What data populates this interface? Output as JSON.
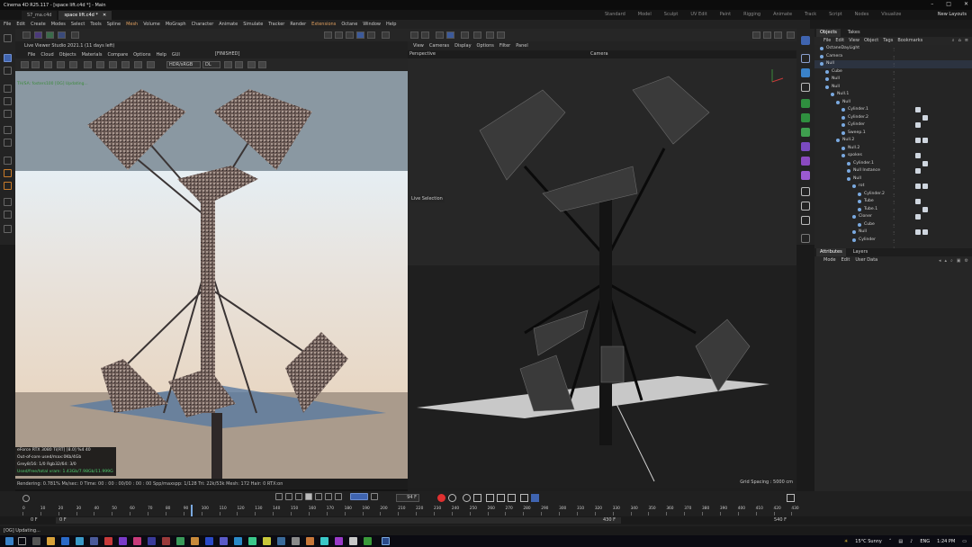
{
  "window": {
    "title": "Cinema 4D R25.117 - [space lift.c4d *] - Main"
  },
  "tabs": [
    {
      "label": "S7_ma.c4d"
    },
    {
      "label": "space lift.c4d *"
    }
  ],
  "layouts": [
    "Standard",
    "Model",
    "Sculpt",
    "UV Edit",
    "Paint",
    "Rigging",
    "Animate",
    "Track",
    "Script",
    "Nodes",
    "Visualize"
  ],
  "new_layouts": "New Layouts",
  "menubar": [
    "File",
    "Edit",
    "Create",
    "Modes",
    "Select",
    "Tools",
    "Spline",
    "Mesh",
    "Volume",
    "MoGraph",
    "Character",
    "Animate",
    "Simulate",
    "Tracker",
    "Render",
    "Extensions",
    "Octane",
    "Window",
    "Help"
  ],
  "live_viewer": {
    "title": "Live Viewer Studio 2021.1 (11 days left)",
    "menu": [
      "File",
      "Cloud",
      "Objects",
      "Materials",
      "Compare",
      "Options",
      "Help",
      "GUI"
    ],
    "status_tag": "[FINISHED]",
    "mode": "HDR/sRGB",
    "channel": "DL",
    "overlay_text": "TH/SA: fosters100  [OG] Updating...",
    "stats": [
      "eForce RTX 3080 Ti[RT]   [8.0] %4      40",
      "Out-of-core used/max:0Kb/4Gb",
      "Grey8/16: 1/0            Rgb32/64: 3/0",
      "Used/free/total vram: 1.43Gb/7.98Gb/11.999G"
    ],
    "status_bar": "Rendering: 0.781%   Ms/sec: 0   Time: 00 : 00 : 00/00 : 00 : 00   Spp/maxspp: 1/128   Tri: 22k/53k   Mesh: 172   Hair: 0   RTX:on"
  },
  "viewport": {
    "menu": [
      "View",
      "Cameras",
      "Display",
      "Options",
      "Filter",
      "Panel"
    ],
    "label": "Perspective",
    "camera": "Camera",
    "live_selection": "Live Selection",
    "grid_spacing": "Grid Spacing : 5000 cm"
  },
  "objects_panel": {
    "tabs": [
      "Objects",
      "Takes"
    ],
    "menu": [
      "File",
      "Edit",
      "View",
      "Object",
      "Tags",
      "Bookmarks"
    ],
    "items": [
      {
        "name": "OctaneDayLight",
        "depth": 0
      },
      {
        "name": "Camera",
        "depth": 0
      },
      {
        "name": "Null",
        "depth": 0
      },
      {
        "name": "Cube",
        "depth": 1
      },
      {
        "name": "Null",
        "depth": 1
      },
      {
        "name": "Null",
        "depth": 1
      },
      {
        "name": "Null.1",
        "depth": 2
      },
      {
        "name": "Null",
        "depth": 3
      },
      {
        "name": "Cylinder.1",
        "depth": 4
      },
      {
        "name": "Cylinder.2",
        "depth": 4
      },
      {
        "name": "Cylinder",
        "depth": 4
      },
      {
        "name": "Sweep.1",
        "depth": 4
      },
      {
        "name": "Null.2",
        "depth": 3
      },
      {
        "name": "Null.2",
        "depth": 4
      },
      {
        "name": "spokes",
        "depth": 4
      },
      {
        "name": "Cylinder.1",
        "depth": 5
      },
      {
        "name": "Null Instance",
        "depth": 5
      },
      {
        "name": "Null",
        "depth": 5
      },
      {
        "name": "rot",
        "depth": 6
      },
      {
        "name": "Cylinder.2",
        "depth": 7
      },
      {
        "name": "Tube",
        "depth": 7
      },
      {
        "name": "Tube.1",
        "depth": 7
      },
      {
        "name": "Cloner",
        "depth": 6
      },
      {
        "name": "Cube",
        "depth": 7
      },
      {
        "name": "Null",
        "depth": 6
      },
      {
        "name": "Cylinder",
        "depth": 6
      }
    ]
  },
  "attributes_panel": {
    "tabs": [
      "Attributes",
      "Layers"
    ],
    "menu": [
      "Mode",
      "Edit",
      "User Data"
    ]
  },
  "timeline": {
    "current_frame": "94 F",
    "ticks": [
      "0",
      "10",
      "20",
      "30",
      "40",
      "50",
      "60",
      "70",
      "80",
      "90",
      "100",
      "110",
      "120",
      "130",
      "140",
      "150",
      "160",
      "170",
      "180",
      "190",
      "200",
      "210",
      "220",
      "230",
      "240",
      "250",
      "260",
      "270",
      "280",
      "290",
      "300",
      "310",
      "320",
      "330",
      "340",
      "350",
      "360",
      "370",
      "380",
      "390",
      "400",
      "410",
      "420",
      "430"
    ],
    "start_frame": "0 F",
    "range_start": "0 F",
    "range_end": "430 F",
    "end_frame": "540 F"
  },
  "status_bar": {
    "text": "[OG] Updating..."
  },
  "taskbar": {
    "weather": "15°C  Sunny",
    "language": "ENG",
    "time": "1:24 PM"
  },
  "colors": {
    "accent_blue": "#3f64b0",
    "record_red": "#e03030",
    "highlight_orange": "#e0a060"
  }
}
